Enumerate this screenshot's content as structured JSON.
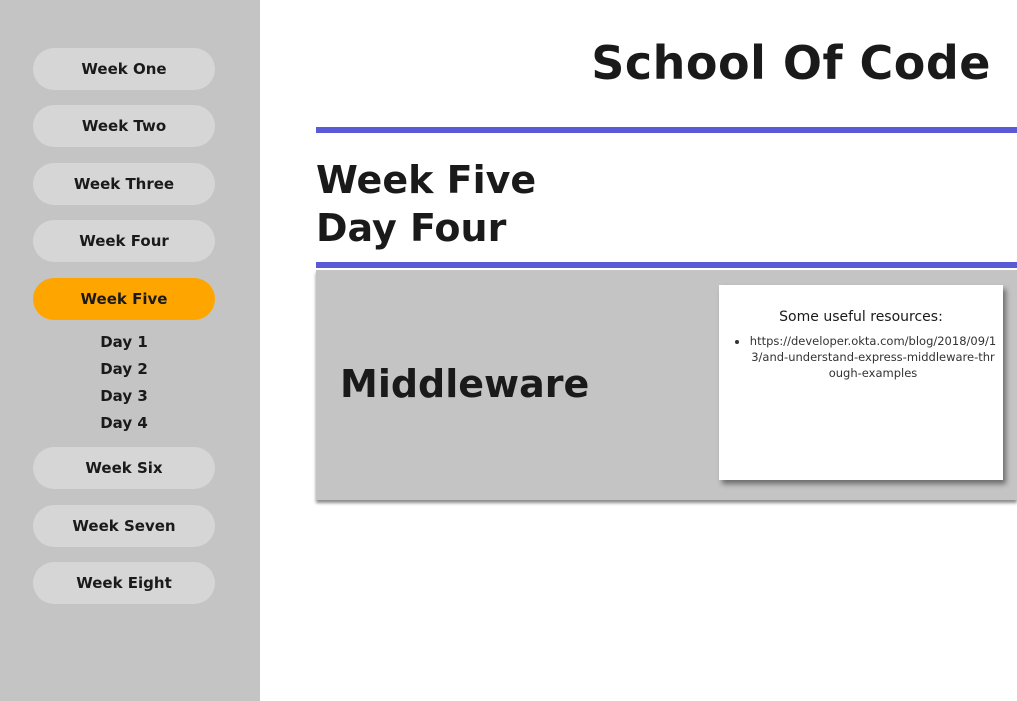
{
  "sidebar": {
    "weeks": [
      {
        "label": "Week One"
      },
      {
        "label": "Week Two"
      },
      {
        "label": "Week Three"
      },
      {
        "label": "Week Four"
      },
      {
        "label": "Week Five",
        "active": true
      },
      {
        "label": "Week Six"
      },
      {
        "label": "Week Seven"
      },
      {
        "label": "Week Eight"
      }
    ],
    "days": [
      "Day 1",
      "Day 2",
      "Day 3",
      "Day 4"
    ]
  },
  "header": {
    "site_title": "School Of Code"
  },
  "page": {
    "week": "Week Five",
    "day": "Day Four"
  },
  "topic": {
    "title": "Middleware",
    "resources_heading": "Some useful resources:",
    "resources": [
      "https://developer.okta.com/blog/2018/09/13/and-understand-express-middleware-through-examples"
    ]
  },
  "colors": {
    "accent_active": "#ffa500",
    "rule": "#5a5ad6",
    "panel": "#c4c4c4"
  }
}
